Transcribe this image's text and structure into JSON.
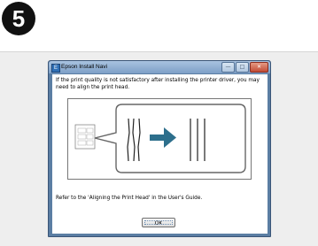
{
  "step": {
    "number": "5"
  },
  "window": {
    "title": "Epson Install Navi",
    "controls": {
      "minimize": "—",
      "maximize": "□",
      "close": "✕"
    }
  },
  "dialog": {
    "message": "If the print quality is not satisfactory after installing the printer driver, you may need to align the print head.",
    "reference": "Refer to the 'Aligning the Print Head' in the User's Guide.",
    "ok_label": "OK"
  },
  "colors": {
    "arrow": "#2d6f8c",
    "titlebar": "#8fb0d6"
  },
  "icons": [
    "epson-app-icon",
    "right-arrow-icon",
    "printout-icon"
  ]
}
